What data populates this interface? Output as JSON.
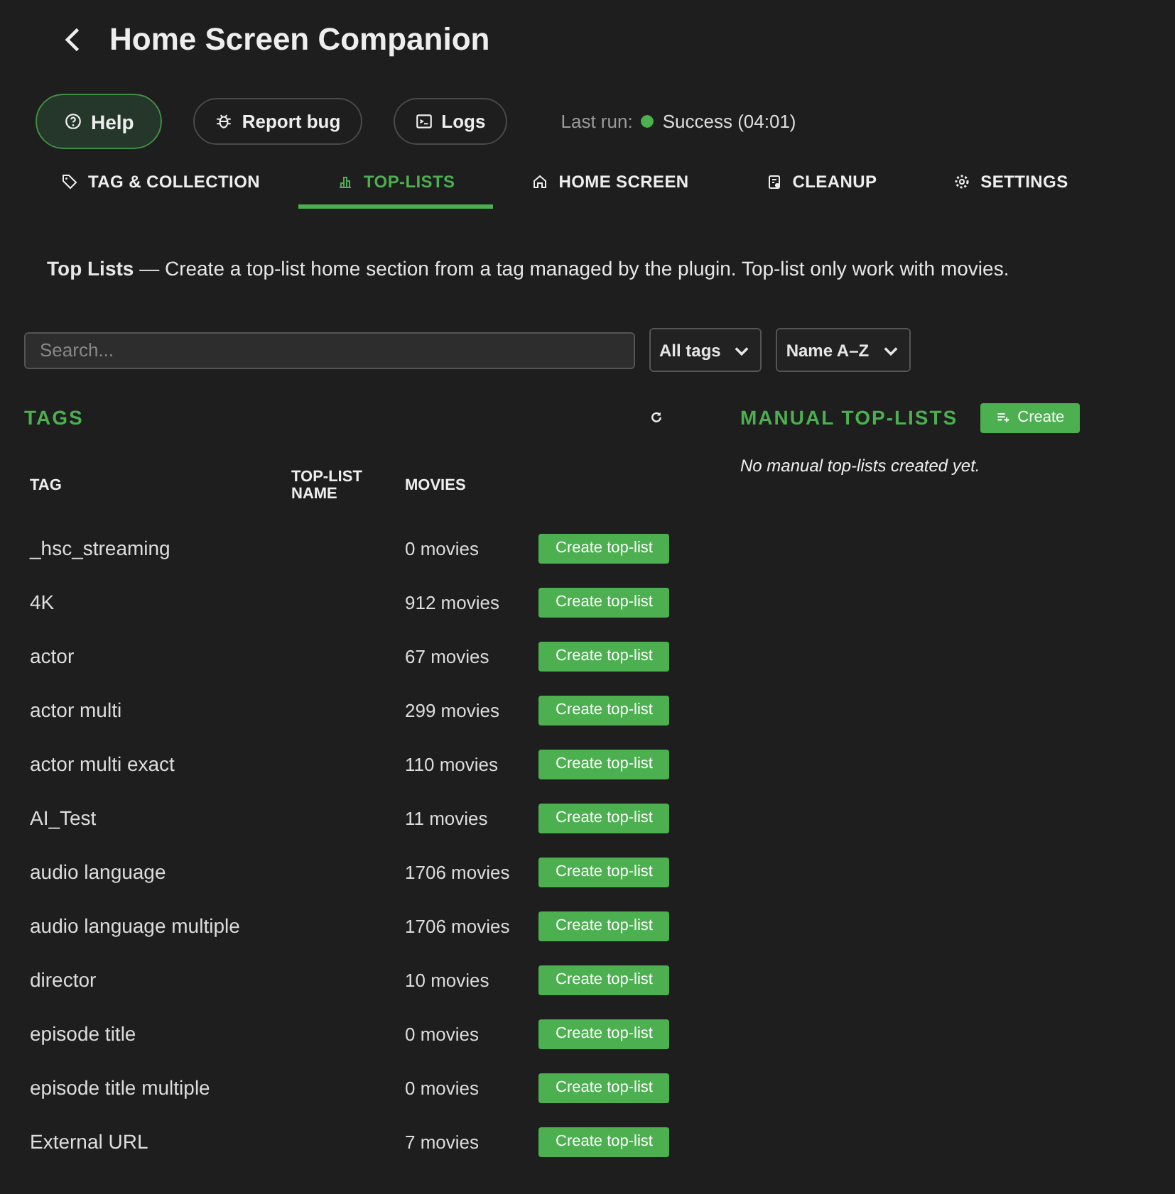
{
  "header": {
    "title": "Home Screen Companion"
  },
  "actions": [
    {
      "label": "Help",
      "kind": "help"
    },
    {
      "label": "Report bug",
      "kind": "bug"
    },
    {
      "label": "Logs",
      "kind": "logs"
    }
  ],
  "last_run": {
    "label": "Last run:",
    "status": "Success (04:01)",
    "color": "#4caf50"
  },
  "tabs": [
    {
      "label": "TAG & COLLECTION",
      "kind": "tag",
      "selected": false
    },
    {
      "label": "TOP-LISTS",
      "kind": "chart",
      "selected": true
    },
    {
      "label": "HOME SCREEN",
      "kind": "home",
      "selected": false
    },
    {
      "label": "CLEANUP",
      "kind": "cleanup",
      "selected": false
    },
    {
      "label": "SETTINGS",
      "kind": "gear",
      "selected": false
    }
  ],
  "description": "**Top Lists** — Create a top-list home section from a tag managed by the plugin. Top-list only work with movies.",
  "filters": {
    "search": {
      "placeholder": "Search..."
    },
    "tag_filter": "All tags",
    "sort": "Name A–Z"
  },
  "tags": {
    "title": "TAGS",
    "columns": [
      "TAG",
      "TOP-LIST NAME",
      "MOVIES"
    ],
    "rows": [
      {
        "tag": "_hsc_streaming",
        "movies": "0 movies",
        "action": "Create top-list"
      },
      {
        "tag": "4K",
        "movies": "912 movies",
        "action": "Create top-list"
      },
      {
        "tag": "actor",
        "movies": "67 movies",
        "action": "Create top-list"
      },
      {
        "tag": "actor multi",
        "movies": "299 movies",
        "action": "Create top-list"
      },
      {
        "tag": "actor multi exact",
        "movies": "110 movies",
        "action": "Create top-list"
      },
      {
        "tag": "AI_Test",
        "movies": "11 movies",
        "action": "Create top-list"
      },
      {
        "tag": "audio language",
        "movies": "1706 movies",
        "action": "Create top-list"
      },
      {
        "tag": "audio language multiple",
        "movies": "1706 movies",
        "action": "Create top-list"
      },
      {
        "tag": "director",
        "movies": "10 movies",
        "action": "Create top-list"
      },
      {
        "tag": "episode title",
        "movies": "0 movies",
        "action": "Create top-list"
      },
      {
        "tag": "episode title multiple",
        "movies": "0 movies",
        "action": "Create top-list"
      },
      {
        "tag": "External URL",
        "movies": "7 movies",
        "action": "Create top-list"
      }
    ]
  },
  "manual": {
    "title": "MANUAL TOP-LISTS",
    "create": "Create",
    "empty": "No manual top-lists created yet."
  }
}
